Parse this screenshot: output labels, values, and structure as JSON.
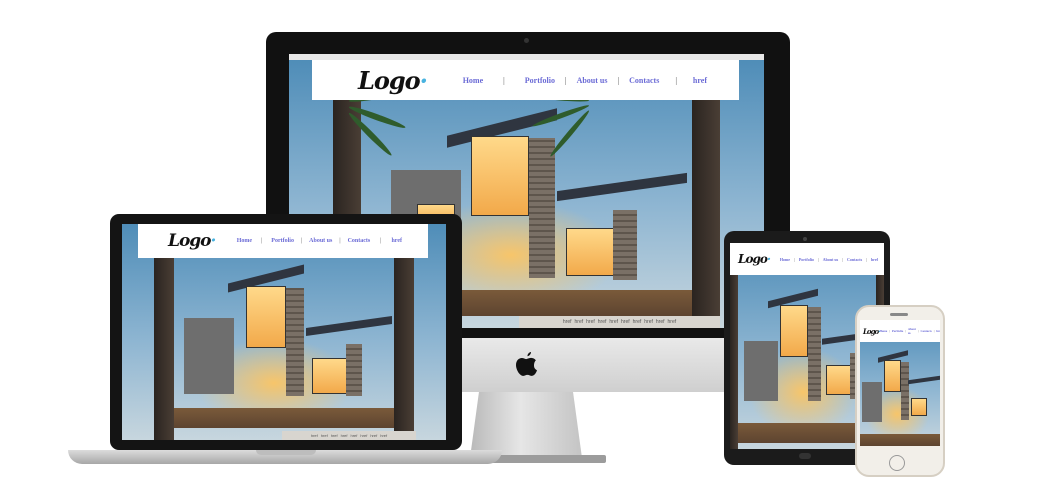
{
  "website": {
    "logo": "Logo",
    "nav": [
      "Home",
      "Portfolio",
      "About us",
      "Contacts",
      "href"
    ],
    "separator": "|",
    "footer_link": "href"
  },
  "colors": {
    "nav_link": "#6b6bd6",
    "logo_accent": "#49b3e0",
    "device_dark": "#111111",
    "device_silver": "#cfcfcf"
  },
  "icons": [
    "apple-logo-icon"
  ]
}
